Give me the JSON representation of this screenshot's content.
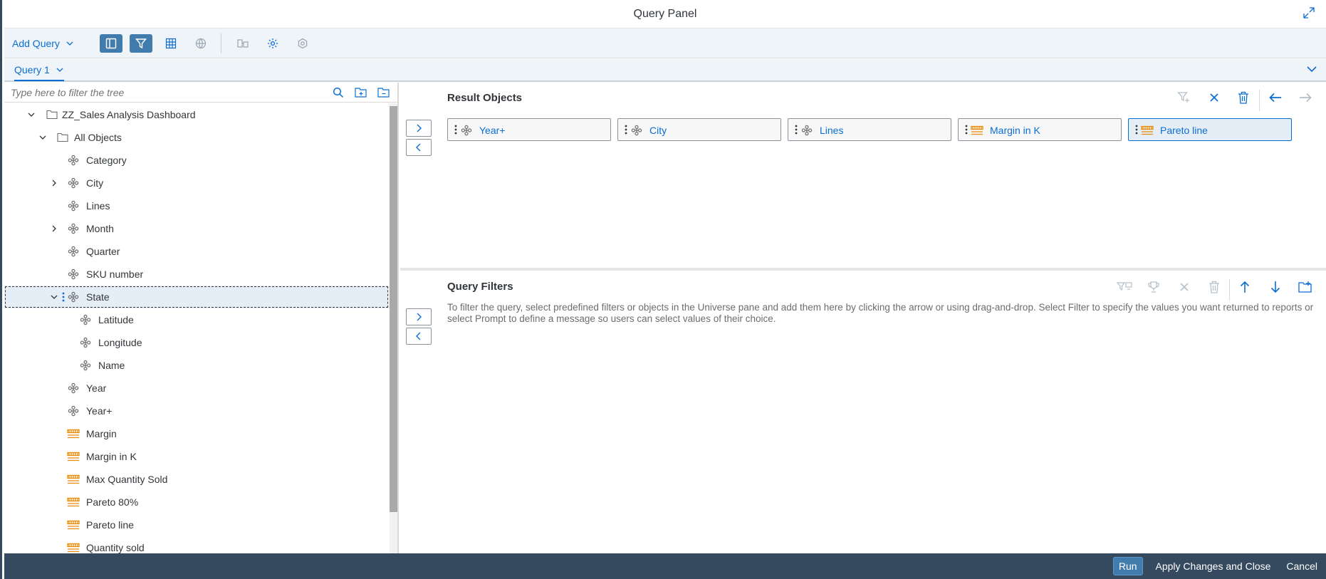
{
  "window": {
    "title": "Query Panel",
    "expand_icon": "expand-icon"
  },
  "toolbar": {
    "add_query_label": "Add Query",
    "buttons": [
      {
        "name": "toggle-outline-button",
        "icon": "panel-icon",
        "active": true
      },
      {
        "name": "filter-pane-button",
        "icon": "filter-icon",
        "active": true
      },
      {
        "name": "data-preview-button",
        "icon": "table-icon",
        "active": false
      },
      {
        "name": "universe-button",
        "icon": "globe-icon",
        "active": false
      }
    ]
  },
  "tabs": {
    "active_label": "Query 1"
  },
  "tree": {
    "filter_placeholder": "Type here to filter the tree",
    "nodes": [
      {
        "label": "ZZ_Sales Analysis Dashboard",
        "level": 0,
        "type": "folder",
        "expanded": true
      },
      {
        "label": "All Objects",
        "level": 1,
        "type": "folder",
        "expanded": true
      },
      {
        "label": "Category",
        "level": 2,
        "type": "dimension"
      },
      {
        "label": "City",
        "level": 2,
        "type": "dimension",
        "collapsed": true
      },
      {
        "label": "Lines",
        "level": 2,
        "type": "dimension"
      },
      {
        "label": "Month",
        "level": 2,
        "type": "dimension",
        "collapsed": true
      },
      {
        "label": "Quarter",
        "level": 2,
        "type": "dimension"
      },
      {
        "label": "SKU number",
        "level": 2,
        "type": "dimension"
      },
      {
        "label": "State",
        "level": 2,
        "type": "dimension",
        "expanded": true,
        "selected": true
      },
      {
        "label": "Latitude",
        "level": 3,
        "type": "attribute"
      },
      {
        "label": "Longitude",
        "level": 3,
        "type": "attribute"
      },
      {
        "label": "Name",
        "level": 3,
        "type": "attribute"
      },
      {
        "label": "Year",
        "level": 2,
        "type": "dimension"
      },
      {
        "label": "Year+",
        "level": 2,
        "type": "dimension"
      },
      {
        "label": "Margin",
        "level": 2,
        "type": "measure"
      },
      {
        "label": "Margin in K",
        "level": 2,
        "type": "measure"
      },
      {
        "label": "Max Quantity Sold",
        "level": 2,
        "type": "measure"
      },
      {
        "label": "Pareto 80%",
        "level": 2,
        "type": "measure"
      },
      {
        "label": "Pareto line",
        "level": 2,
        "type": "measure"
      },
      {
        "label": "Quantity sold",
        "level": 2,
        "type": "measure"
      }
    ]
  },
  "result_objects": {
    "title": "Result Objects",
    "items": [
      {
        "label": "Year+",
        "type": "dimension"
      },
      {
        "label": "City",
        "type": "dimension"
      },
      {
        "label": "Lines",
        "type": "dimension"
      },
      {
        "label": "Margin in K",
        "type": "measure"
      },
      {
        "label": "Pareto line",
        "type": "measure",
        "selected": true
      }
    ]
  },
  "query_filters": {
    "title": "Query Filters",
    "help_text": "To filter the query, select predefined filters or objects in the Universe pane and add them here by clicking the arrow or using drag-and-drop. Select Filter to specify the values you want returned to reports or select Prompt to define a message so users can select values of their choice."
  },
  "footer": {
    "run_label": "Run",
    "apply_label": "Apply Changes and Close",
    "cancel_label": "Cancel"
  },
  "colors": {
    "accent": "#0a6ed1",
    "footer_bg": "#354a5f",
    "toolbar_bg": "#eff4f9",
    "measure_orange": "#e78c07"
  }
}
